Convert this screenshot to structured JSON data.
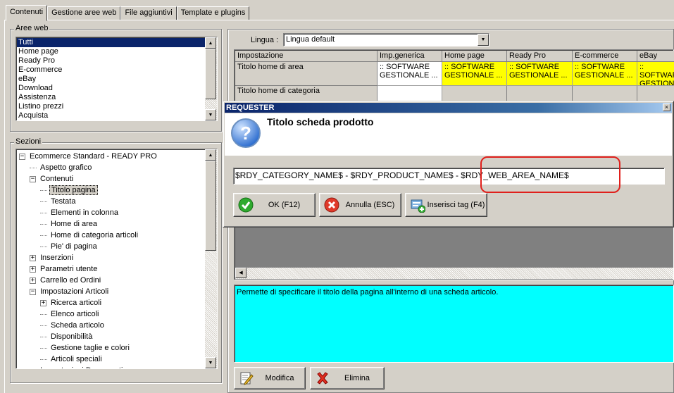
{
  "tabs": [
    "Contenuti",
    "Gestione aree web",
    "File aggiuntivi",
    "Template e plugins"
  ],
  "aree_web": {
    "label": "Aree web",
    "items": [
      "Tutti",
      "Home page",
      "Ready Pro",
      "E-commerce",
      "eBay",
      "Download",
      "Assistenza",
      "Listino prezzi",
      "Acquista"
    ]
  },
  "sezioni": {
    "label": "Sezioni",
    "items": [
      "Ecommerce Standard - READY PRO",
      "Aspetto grafico",
      "Contenuti",
      "Titolo pagina",
      "Testata",
      "Elementi in colonna",
      "Home di area",
      "Home di categoria articoli",
      "Pie' di pagina",
      "Inserzioni",
      "Parametri utente",
      "Carrello ed Ordini",
      "Impostazioni Articoli",
      "Ricerca articoli",
      "Elenco articoli",
      "Scheda articolo",
      "Disponibilità",
      "Gestione taglie e colori",
      "Articoli speciali",
      "Impostazioni Documenti"
    ],
    "expanders": [
      "−",
      "−",
      "+",
      "+",
      "+",
      "−",
      "+"
    ]
  },
  "lingua": {
    "label": "Lingua :",
    "value": "Lingua default"
  },
  "grid": {
    "headers": [
      "Impostazione",
      "Imp.generica",
      "Home page",
      "Ready Pro",
      "E-commerce",
      "eBay"
    ],
    "rows": [
      {
        "name": "Titolo home di area",
        "cells": [
          ":: SOFTWARE GESTIONALE ...",
          ":: SOFTWARE GESTIONALE ...",
          ":: SOFTWARE GESTIONALE ...",
          ":: SOFTWARE GESTIONALE ...",
          ":: SOFTWARE GESTIONALE ..."
        ]
      },
      {
        "name": "Titolo home di categoria",
        "cells": [
          "",
          "",
          "",
          "",
          ""
        ]
      }
    ]
  },
  "description": "Permette di specificare il titolo della pagina all'interno di una scheda articolo.",
  "buttons": {
    "modifica": "Modifica",
    "elimina": "Elimina"
  },
  "dialog": {
    "title": "REQUESTER",
    "heading": "Titolo scheda prodotto",
    "input_value": "$RDY_CATEGORY_NAME$ - $RDY_PRODUCT_NAME$ - $RDY_WEB_AREA_NAME$",
    "ok": "OK (F12)",
    "annulla": "Annulla (ESC)",
    "inserisci": "Inserisci tag (F4)"
  },
  "colors": {
    "selection": "#0a246a",
    "highlight_cell": "#ffff00",
    "description_bg": "#00ffff",
    "annotation": "#e0201c"
  }
}
